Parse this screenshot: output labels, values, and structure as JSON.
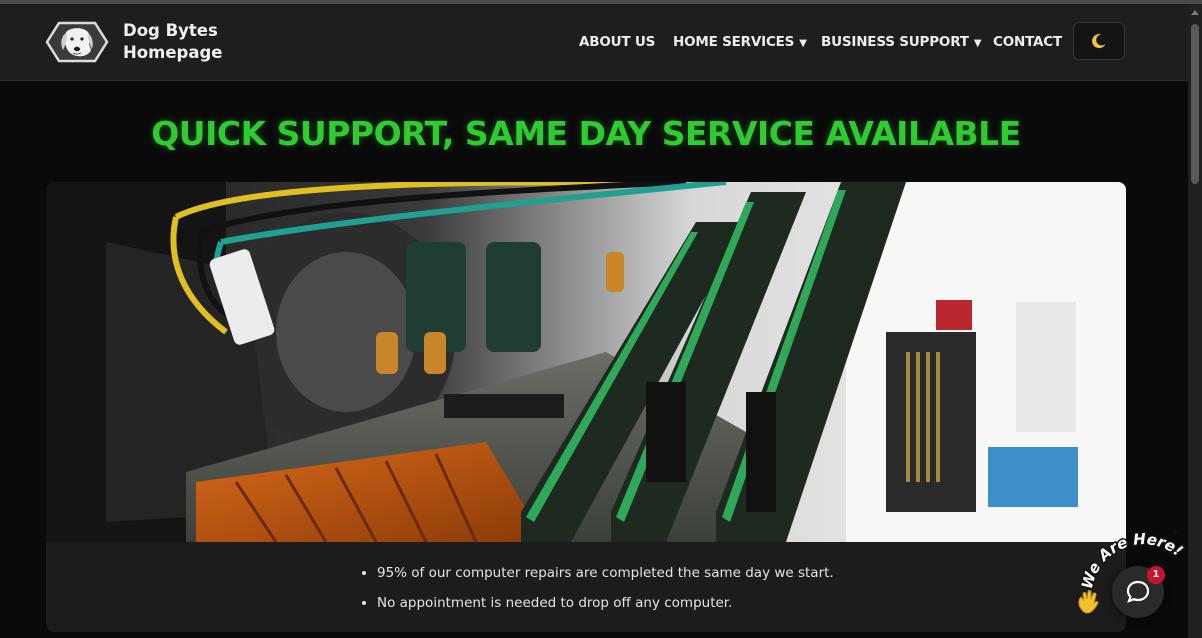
{
  "brand": {
    "title_line1": "Dog Bytes",
    "title_line2": "Homepage",
    "logo_icon": "dog-head-icon"
  },
  "nav": {
    "items": [
      {
        "label": "ABOUT US",
        "has_dropdown": false
      },
      {
        "label": "HOME SERVICES",
        "has_dropdown": true
      },
      {
        "label": "BUSINESS SUPPORT",
        "has_dropdown": true
      },
      {
        "label": "CONTACT",
        "has_dropdown": false
      }
    ],
    "caret": "▼",
    "theme_toggle_icon": "moon-icon"
  },
  "hero": {
    "headline": "QUICK SUPPORT, SAME DAY SERVICE AVAILABLE",
    "image_subject": "computer motherboard with RAM modules",
    "bullets": [
      "95% of our computer repairs are completed the same day we start.",
      "No appointment is needed to drop off any computer."
    ]
  },
  "chat": {
    "prompt": "We Are Here!",
    "badge_count": "1",
    "icon": "chat-icon",
    "wave_icon": "waving-hand-icon"
  },
  "colors": {
    "accent_green": "#2ecc2e",
    "page_bg": "#0a0a0a",
    "nav_bg": "#1e1e1e",
    "badge_red": "#c8142b"
  }
}
